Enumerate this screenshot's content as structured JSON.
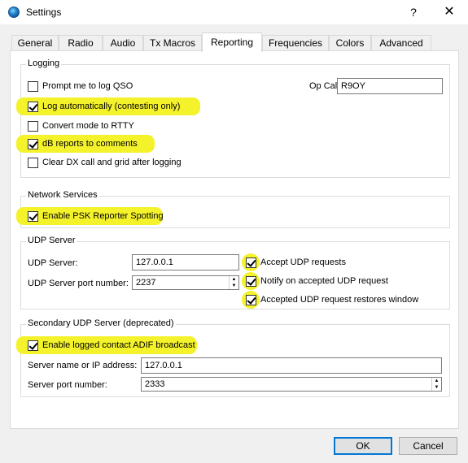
{
  "window": {
    "title": "Settings",
    "help": "?",
    "close": "✕"
  },
  "tabs": [
    {
      "label": "General"
    },
    {
      "label": "Radio"
    },
    {
      "label": "Audio"
    },
    {
      "label": "Tx Macros"
    },
    {
      "label": "Reporting",
      "active": true
    },
    {
      "label": "Frequencies"
    },
    {
      "label": "Colors"
    },
    {
      "label": "Advanced"
    }
  ],
  "logging": {
    "title": "Logging",
    "prompt_log_qso": {
      "label": "Prompt me to log QSO",
      "checked": false
    },
    "log_auto": {
      "label": "Log automatically (contesting only)",
      "checked": true
    },
    "convert_rtty": {
      "label": "Convert mode to RTTY",
      "checked": false
    },
    "db_reports": {
      "label": "dB reports to comments",
      "checked": true
    },
    "clear_dx": {
      "label": "Clear DX call and grid after logging",
      "checked": false
    },
    "op_call_label": "Op Call:",
    "op_call_value": "R9OY"
  },
  "network": {
    "title": "Network Services",
    "psk_reporter": {
      "label": "Enable PSK Reporter Spotting",
      "checked": true
    }
  },
  "udp": {
    "title": "UDP Server",
    "server_label": "UDP Server:",
    "server_value": "127.0.0.1",
    "port_label": "UDP Server port number:",
    "port_value": "2237",
    "accept_requests": {
      "label": "Accept UDP requests",
      "checked": true
    },
    "notify_accepted": {
      "label": "Notify on accepted UDP request",
      "checked": true
    },
    "restore_window": {
      "label": "Accepted UDP request restores window",
      "checked": true
    }
  },
  "secondary_udp": {
    "title": "Secondary UDP Server (deprecated)",
    "adif_broadcast": {
      "label": "Enable logged contact ADIF broadcast",
      "checked": true
    },
    "server_label": "Server name or IP address:",
    "server_value": "127.0.0.1",
    "port_label": "Server port number:",
    "port_value": "2333"
  },
  "buttons": {
    "ok": "OK",
    "cancel": "Cancel"
  },
  "colors": {
    "highlight": "#f4f22b",
    "focus_border": "#0078d7"
  }
}
